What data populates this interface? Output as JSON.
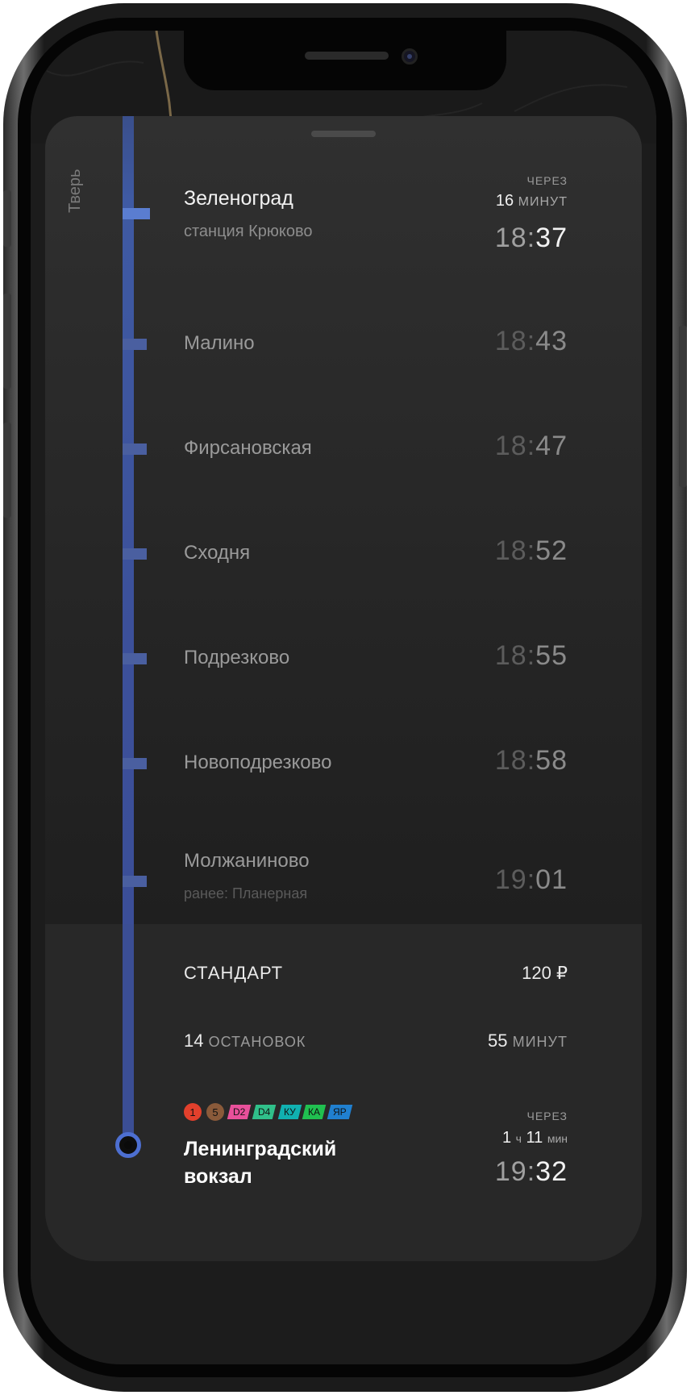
{
  "direction_label": "Тверь",
  "current_stop": {
    "name": "Зеленоград",
    "sub": "станция Крюково",
    "eta_label": "ЧЕРЕЗ",
    "eta_value": "16",
    "eta_unit": "минут",
    "time_h": "18",
    "time_m": "37"
  },
  "stops": [
    {
      "name": "Малино",
      "time_h": "18",
      "time_m": "43"
    },
    {
      "name": "Фирсановская",
      "time_h": "18",
      "time_m": "47"
    },
    {
      "name": "Сходня",
      "time_h": "18",
      "time_m": "52"
    },
    {
      "name": "Подрезково",
      "time_h": "18",
      "time_m": "55"
    },
    {
      "name": "Новоподрезково",
      "time_h": "18",
      "time_m": "58"
    },
    {
      "name": "Молжаниново",
      "time_h": "19",
      "time_m": "01",
      "sub": "ранее: Планерная"
    }
  ],
  "summary": {
    "tariff": "СТАНДАРТ",
    "price": "120 ₽",
    "stops_count": "14",
    "stops_unit": "остановок",
    "duration_value": "55",
    "duration_unit": "минут"
  },
  "transfers": [
    {
      "label": "1",
      "kind": "circle",
      "color": "#e2402c"
    },
    {
      "label": "5",
      "kind": "circle",
      "color": "#8a5a3a"
    },
    {
      "label": "D2",
      "kind": "tag",
      "color": "#e8509a"
    },
    {
      "label": "D4",
      "kind": "tag",
      "color": "#30c08a"
    },
    {
      "label": "КУ",
      "kind": "tag",
      "color": "#10b0b0"
    },
    {
      "label": "КА",
      "kind": "tag",
      "color": "#20c050"
    },
    {
      "label": "ЯР",
      "kind": "tag",
      "color": "#2080d0"
    }
  ],
  "destination": {
    "name": "Ленинградский вокзал",
    "eta_label": "ЧЕРЕЗ",
    "eta_hours": "1",
    "eta_hours_unit": "ч",
    "eta_minutes": "11",
    "eta_minutes_unit": "мин",
    "time_h": "19",
    "time_m": "32"
  },
  "colors": {
    "line": "#3f5aa3",
    "line_current_tick": "#5a7dd0",
    "end_ring": "#4d6fd1"
  }
}
